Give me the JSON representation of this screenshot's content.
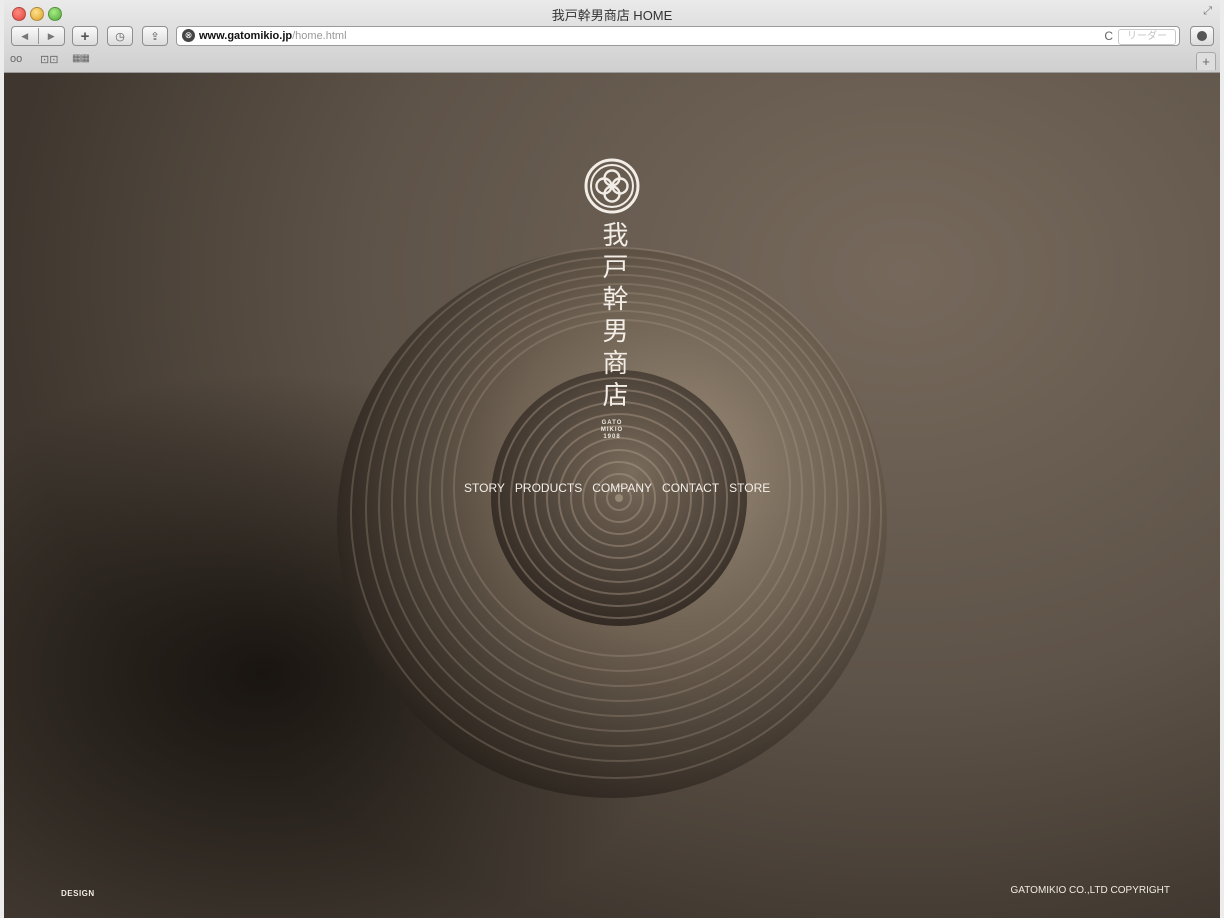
{
  "window": {
    "title": "我戸幹男商店 HOME"
  },
  "toolbar": {
    "back_icon": "◀",
    "forward_icon": "▶",
    "add_icon": "+",
    "history_icon": "◷",
    "share_icon": "⇪",
    "reload_icon": "C",
    "reader_label": "リーダー",
    "site_icon": "⊗"
  },
  "address": {
    "host": "www.gatomikio.jp",
    "path": "/home.html"
  },
  "bookmarks_bar": {
    "reading_list_icon": "oo",
    "bookmarks_icon": "⊡⊡",
    "top_sites_icon": "▦▦"
  },
  "page": {
    "brand_name": "我戸幹男商店",
    "brand_sub": [
      "GATO",
      "MIKIO",
      "1908"
    ],
    "nav": [
      "STORY",
      "PRODUCTS",
      "COMPANY",
      "CONTACT",
      "STORE"
    ],
    "footer_left": "DESIGN",
    "footer_right": "GATOMIKIO CO.,LTD COPYRIGHT"
  },
  "colors": {
    "background": "#5e5348",
    "bowl": "#6a5c4e",
    "text": "#f2ede6"
  }
}
